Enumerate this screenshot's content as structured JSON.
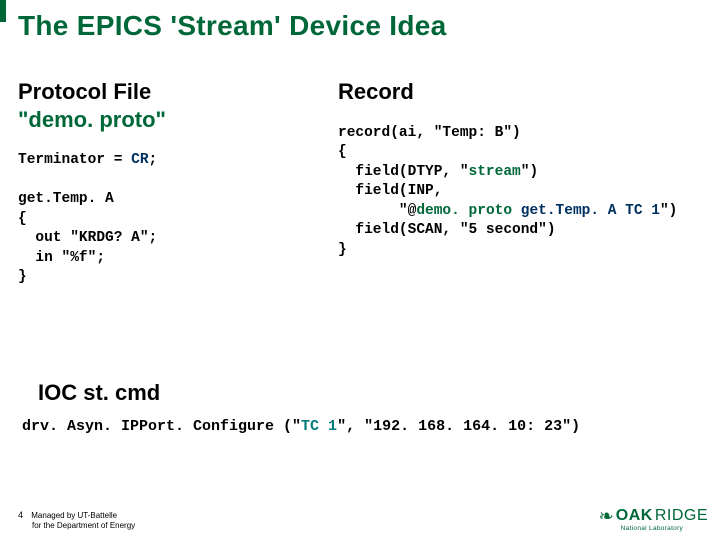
{
  "title": "The EPICS 'Stream' Device Idea",
  "left": {
    "heading_plain": "Protocol File",
    "heading_quoted": "\"demo. proto\"",
    "code_line1_a": "Terminator = ",
    "code_line1_b": "CR",
    "code_line1_c": ";",
    "code_block": "get.Temp. A\n{\n  out \"KRDG? A\";\n  in \"%f\";\n}"
  },
  "right": {
    "heading": "Record",
    "code_l1": "record(ai, \"Temp: B\")",
    "code_l2": "{",
    "code_l3a": "  field(DTYP, \"",
    "code_l3b": "stream",
    "code_l3c": "\")",
    "code_l4": "  field(INP,",
    "code_l5a": "       \"@",
    "code_l5b": "demo. proto",
    "code_l5c": " ",
    "code_l5d": "get.Temp. A",
    "code_l5e": " ",
    "code_l5f": "TC 1",
    "code_l5g": "\")",
    "code_l6": "  field(SCAN, \"5 second\")",
    "code_l7": "}"
  },
  "ioc": {
    "heading": "IOC st. cmd",
    "code_a": "drv. Asyn. IPPort. Configure (\"",
    "code_b": "TC 1",
    "code_c": "\", \"192. 168. 164. 10: 23\")"
  },
  "footer": {
    "num": "4",
    "line1": "Managed by UT-Battelle",
    "line2": "for the Department of Energy"
  },
  "logo": {
    "oak": "OAK",
    "ridge": "RIDGE",
    "sub": "National Laboratory"
  }
}
